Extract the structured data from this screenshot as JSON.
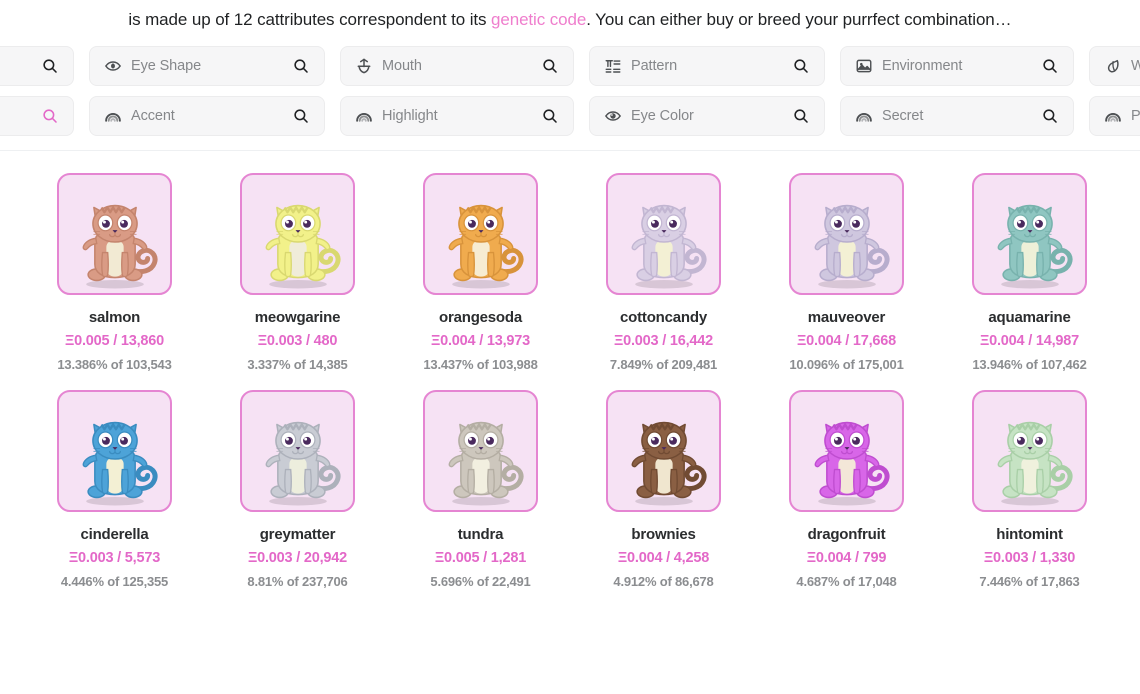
{
  "banner": {
    "text_before": " is made up of 12 cattributes correspondent to its ",
    "link": "genetic code",
    "text_after": ". You can either buy or breed your purrfect combination…"
  },
  "filters": {
    "row1": [
      {
        "label": "",
        "icon": "none",
        "search_icon": "search-icon",
        "width": "first",
        "clipped": true
      },
      {
        "label": "Eye Shape",
        "icon": "eye-shape-icon",
        "search_icon": "search-icon",
        "width": "std"
      },
      {
        "label": "Mouth",
        "icon": "mouth-icon",
        "search_icon": "search-icon",
        "width": "std2"
      },
      {
        "label": "Pattern",
        "icon": "pattern-icon",
        "search_icon": "search-icon",
        "width": "std"
      },
      {
        "label": "Environment",
        "icon": "environment-icon",
        "search_icon": "search-icon",
        "width": "std2"
      },
      {
        "label": "Wild",
        "icon": "wild-icon",
        "search_icon": "search-icon",
        "width": "last",
        "clipped": true
      }
    ],
    "row2": [
      {
        "label": "",
        "icon": "none",
        "search_icon": "search-icon",
        "width": "first",
        "clipped": true,
        "accent": true
      },
      {
        "label": "Accent",
        "icon": "rainbow-icon",
        "search_icon": "search-icon",
        "width": "std"
      },
      {
        "label": "Highlight",
        "icon": "rainbow-icon",
        "search_icon": "search-icon",
        "width": "std2"
      },
      {
        "label": "Eye Color",
        "icon": "eye-color-icon",
        "search_icon": "search-icon",
        "width": "std"
      },
      {
        "label": "Secret",
        "icon": "rainbow-icon",
        "search_icon": "search-icon",
        "width": "std2"
      },
      {
        "label": "Purr",
        "icon": "rainbow-icon",
        "search_icon": "search-icon",
        "width": "last",
        "clipped": true
      }
    ]
  },
  "colors": {
    "accent": "#e368c8",
    "card_border": "#e585d2",
    "card_bg": "#f6e2f4",
    "link": "#ef7ecd",
    "chip_bg": "#f6f6f7",
    "muted_text": "#8b8d90"
  },
  "cats": [
    {
      "name": "salmon",
      "price": "Ξ0.005 / 13,860",
      "stat": "13.386% of 103,543",
      "body": "#d99b85",
      "belly": "#f2ead3",
      "accent_color": "#c4846d"
    },
    {
      "name": "meowgarine",
      "price": "Ξ0.003 / 480",
      "stat": "3.337% of 14,385",
      "body": "#f2f18a",
      "belly": "#f0ecd9",
      "accent_color": "#d9d870"
    },
    {
      "name": "orangesoda",
      "price": "Ξ0.004 / 13,973",
      "stat": "13.437% of 103,988",
      "body": "#f0ab4e",
      "belly": "#f7ecd2",
      "accent_color": "#d8933b"
    },
    {
      "name": "cottoncandy",
      "price": "Ξ0.003 / 16,442",
      "stat": "7.849% of 209,481",
      "body": "#d9cfe4",
      "belly": "#f3f0d4",
      "accent_color": "#c2b6d2"
    },
    {
      "name": "mauveover",
      "price": "Ξ0.004 / 17,668",
      "stat": "10.096% of 175,001",
      "body": "#cfc7df",
      "belly": "#f3f0d4",
      "accent_color": "#b7adcd"
    },
    {
      "name": "aquamarine",
      "price": "Ξ0.004 / 14,987",
      "stat": "13.946% of 107,462",
      "body": "#8fc6c1",
      "belly": "#eef0d8",
      "accent_color": "#78b2ad"
    },
    {
      "name": "cinderella",
      "price": "Ξ0.003 / 5,573",
      "stat": "4.446% of 125,355",
      "body": "#4da3d8",
      "belly": "#f3f0d4",
      "accent_color": "#3a8cc0"
    },
    {
      "name": "greymatter",
      "price": "Ξ0.003 / 20,942",
      "stat": "8.81% of 237,706",
      "body": "#c9ccd4",
      "belly": "#edeedd",
      "accent_color": "#adb1bb"
    },
    {
      "name": "tundra",
      "price": "Ξ0.005 / 1,281",
      "stat": "5.696% of 22,491",
      "body": "#cdc7bd",
      "belly": "#f2efe0",
      "accent_color": "#b4aea3"
    },
    {
      "name": "brownies",
      "price": "Ξ0.004 / 4,258",
      "stat": "4.912% of 86,678",
      "body": "#8a5f43",
      "belly": "#f0e6cf",
      "accent_color": "#714b33"
    },
    {
      "name": "dragonfruit",
      "price": "Ξ0.004 / 799",
      "stat": "4.687% of 17,048",
      "body": "#d866e8",
      "belly": "#f3e7d8",
      "accent_color": "#bf4dd0"
    },
    {
      "name": "hintomint",
      "price": "Ξ0.003 / 1,330",
      "stat": "7.446% of 17,863",
      "body": "#c6e3c4",
      "belly": "#f0f1dd",
      "accent_color": "#a9cfa7"
    }
  ]
}
